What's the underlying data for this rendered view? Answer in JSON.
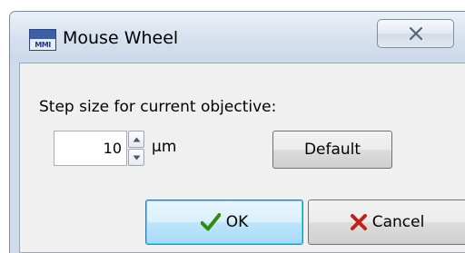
{
  "window": {
    "title": "Mouse Wheel",
    "app_icon_text": "MMI"
  },
  "form": {
    "step_label": "Step size for current objective:",
    "step_value": "10",
    "unit": "μm",
    "default_label": "Default"
  },
  "buttons": {
    "ok_label": "OK",
    "cancel_label": "Cancel"
  },
  "icons": {
    "close": "close-icon",
    "spin_up": "arrow-up-icon",
    "spin_down": "arrow-down-icon",
    "ok": "checkmark-icon",
    "cancel": "x-icon"
  },
  "colors": {
    "ok_check": "#2e8b12",
    "cancel_x": "#c0221b",
    "ok_highlight": "#48d2f8"
  }
}
